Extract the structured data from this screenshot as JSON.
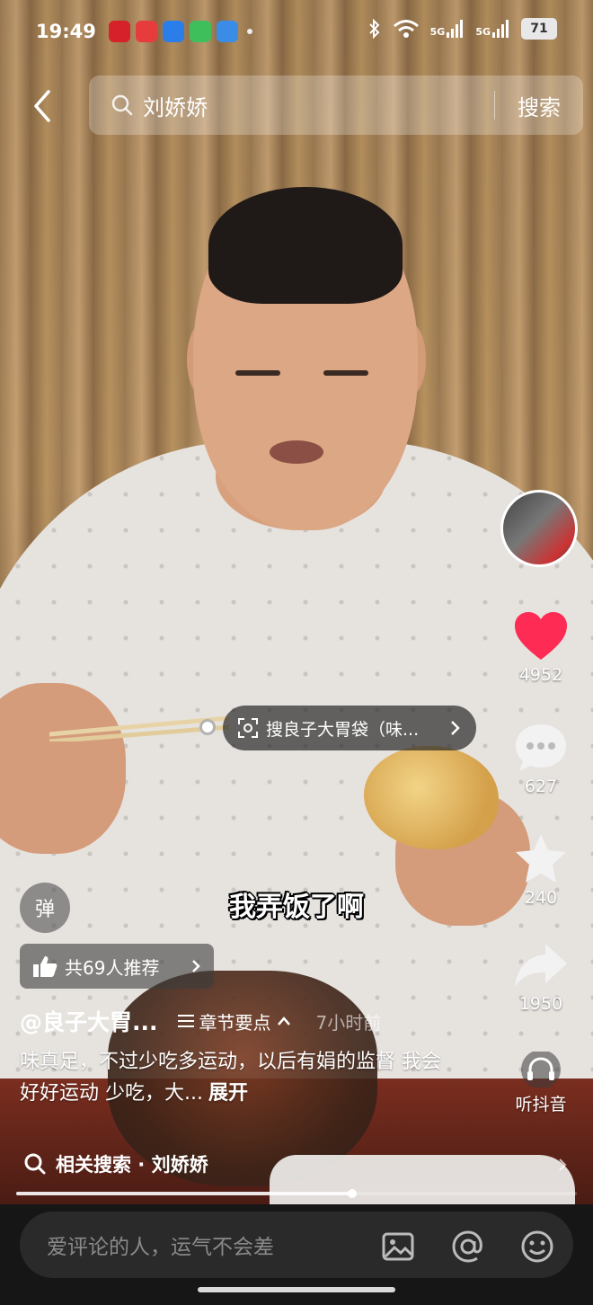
{
  "status_bar": {
    "time": "19:49",
    "apps": [
      {
        "name": "中红网",
        "color": "#d6202a"
      },
      {
        "name": "头条",
        "color": "#e63c3c"
      },
      {
        "name": "cloud",
        "color": "#2b7de9"
      },
      {
        "name": "play",
        "color": "#3fbf5b"
      },
      {
        "name": "browser",
        "color": "#3a8ce6"
      }
    ],
    "network_1": "5G",
    "network_2": "5G",
    "battery": "71"
  },
  "search": {
    "query": "刘娇娇",
    "button": "搜索"
  },
  "right_rail": {
    "likes": "4952",
    "comments": "627",
    "favorites": "240",
    "shares": "1950",
    "listen_label": "听抖音",
    "like_color": "#fe2c55"
  },
  "product_tag": {
    "text": "搜良子大胃袋（味..."
  },
  "subtitle": "我弄饭了啊",
  "danmu_label": "弹",
  "recommend": {
    "text": "共69人推荐"
  },
  "author": {
    "name": "@良子大胃...",
    "chapters": "章节要点",
    "posted": "7小时前"
  },
  "caption": {
    "text": "味真足，不过少吃多运动，以后有娟的监督 我会好好运动 少吃，大...",
    "expand": "展开"
  },
  "related_search": {
    "text": "相关搜索 · 刘娇娇"
  },
  "video_progress": 0.6,
  "comment_bar": {
    "placeholder": "爱评论的人，运气不会差"
  }
}
